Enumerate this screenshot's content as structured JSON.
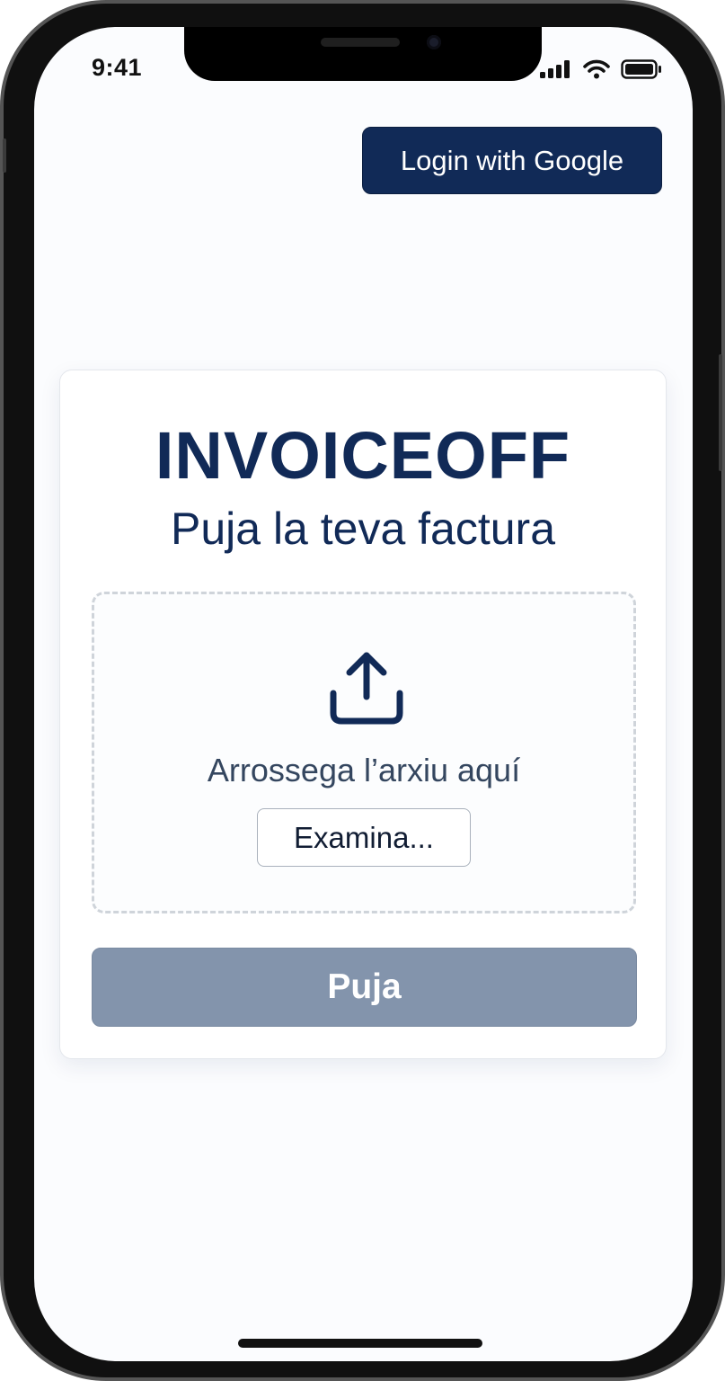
{
  "status_bar": {
    "time": "9:41",
    "icons": [
      "cellular-signal-icon",
      "wifi-icon",
      "battery-icon"
    ]
  },
  "header": {
    "login_button_label": "Login with Google"
  },
  "card": {
    "title": "INVOICEOFF",
    "subtitle": "Puja la teva factura",
    "dropzone": {
      "icon": "upload-icon",
      "text": "Arrossega l’arxiu aquí",
      "browse_label": "Examina..."
    },
    "submit_label": "Puja"
  },
  "colors": {
    "brand_navy": "#112a57",
    "submit_disabled": "#8394ac",
    "background": "#fbfcfe",
    "dropzone_border": "#cfd4da"
  }
}
